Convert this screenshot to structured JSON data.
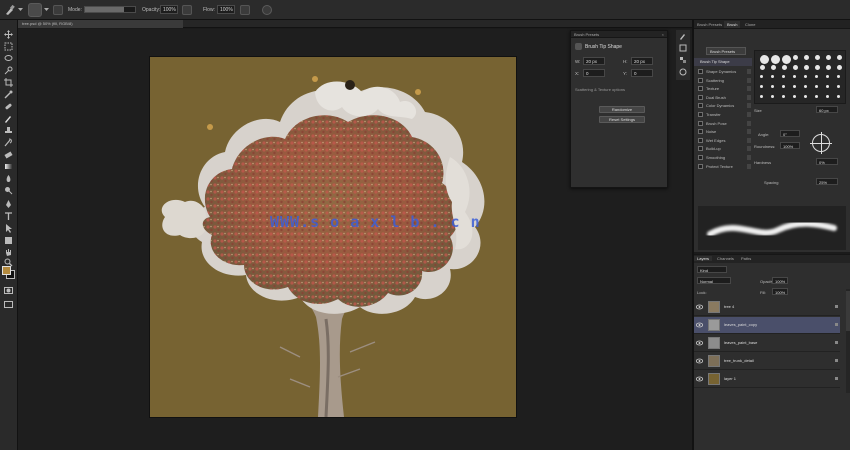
{
  "options_bar": {
    "mode_label": "Mode:",
    "opacity_label": "Opacity:",
    "opacity_value": "100%",
    "flow_label": "Flow:",
    "flow_value": "100%",
    "flow_fill_fraction": 0.78
  },
  "document": {
    "tab_title": "tree.psd @ 50% (fill, RGB/8)"
  },
  "watermark": {
    "text": "WWW.s o a x l b . c n"
  },
  "floating_panel": {
    "header": "Brush Presets",
    "title": "Brush Tip Shape",
    "row1_label": "W:",
    "row1_value": "20 px",
    "row2_label": "H:",
    "row2_value": "20 px",
    "row3_label": "X:",
    "row3_value": "0",
    "row4_label": "Y:",
    "row4_value": "0",
    "note": "Scattering & Texture options",
    "btn1": "Randomize",
    "btn2": "Reset Settings"
  },
  "brush_panel": {
    "tabs": [
      "Brush Presets",
      "Brush",
      "Clone"
    ],
    "active_tab": 1,
    "top_button": "Brush Presets",
    "head": "Brush Tip Shape",
    "list": [
      "Shape Dynamics",
      "Scattering",
      "Texture",
      "Dual Brush",
      "Color Dynamics",
      "Transfer",
      "Brush Pose",
      "Noise",
      "Wet Edges",
      "Build-up",
      "Smoothing",
      "Protect Texture"
    ],
    "size_label": "Size",
    "size_value": "60 px",
    "angle_label": "Angle:",
    "angle_value": "0°",
    "roundness_label": "Roundness:",
    "roundness_value": "100%",
    "hardness_label": "Hardness",
    "hardness_value": "0%",
    "spacing_label": "Spacing",
    "spacing_value": "25%"
  },
  "layers_panel": {
    "tabs": [
      "Layers",
      "Channels",
      "Paths"
    ],
    "active_tab": 0,
    "kind_label": "Kind",
    "blend_mode": "Normal",
    "opacity_label": "Opacity:",
    "opacity_value": "100%",
    "lock_label": "Lock:",
    "fill_label": "Fill:",
    "fill_value": "100%",
    "layers": [
      {
        "name": "tree 4",
        "selected": false,
        "thumb_color": "#8a7a60"
      },
      {
        "name": "leaves_paint_copy",
        "selected": true,
        "thumb_color": "#9a9a9a"
      },
      {
        "name": "leaves_paint_base",
        "selected": false,
        "thumb_color": "#8c8c8c"
      },
      {
        "name": "tree_trunk_detail",
        "selected": false,
        "thumb_color": "#7d6f58"
      },
      {
        "name": "layer 1",
        "selected": false,
        "thumb_color": "#776332"
      }
    ]
  },
  "colors": {
    "canvas_fill": "#776332",
    "foreground": "#b38a3e",
    "selection": "#4a4f6a",
    "watermark": "#3d5fd6"
  }
}
